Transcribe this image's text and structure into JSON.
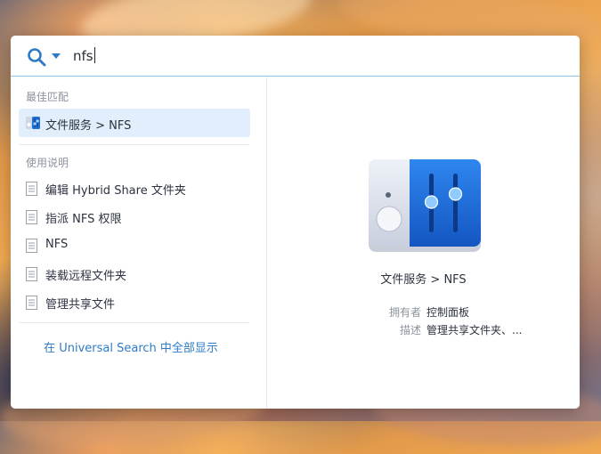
{
  "search": {
    "query": "nfs"
  },
  "results": {
    "best_match_heading": "最佳匹配",
    "best_match": {
      "label": "文件服务 > NFS",
      "icon": "control-panel-file-services-icon"
    },
    "help_heading": "使用说明",
    "help_items": [
      {
        "label": "编辑 Hybrid Share 文件夹",
        "icon": "document-icon"
      },
      {
        "label": "指派 NFS 权限",
        "icon": "document-icon"
      },
      {
        "label": "NFS",
        "icon": "document-icon"
      },
      {
        "label": "装载远程文件夹",
        "icon": "document-icon"
      },
      {
        "label": "管理共享文件",
        "icon": "document-icon"
      }
    ],
    "show_all": "在 Universal Search 中全部显示"
  },
  "preview": {
    "title": "文件服务 > NFS",
    "icon": "control-panel-sliders-icon",
    "owner_label": "拥有者",
    "owner_value": "控制面板",
    "desc_label": "描述",
    "desc_value": "管理共享文件夹、..."
  },
  "colors": {
    "accent": "#2f7bc6",
    "selection": "#e2eefb",
    "search_border": "#8ec5ec"
  }
}
